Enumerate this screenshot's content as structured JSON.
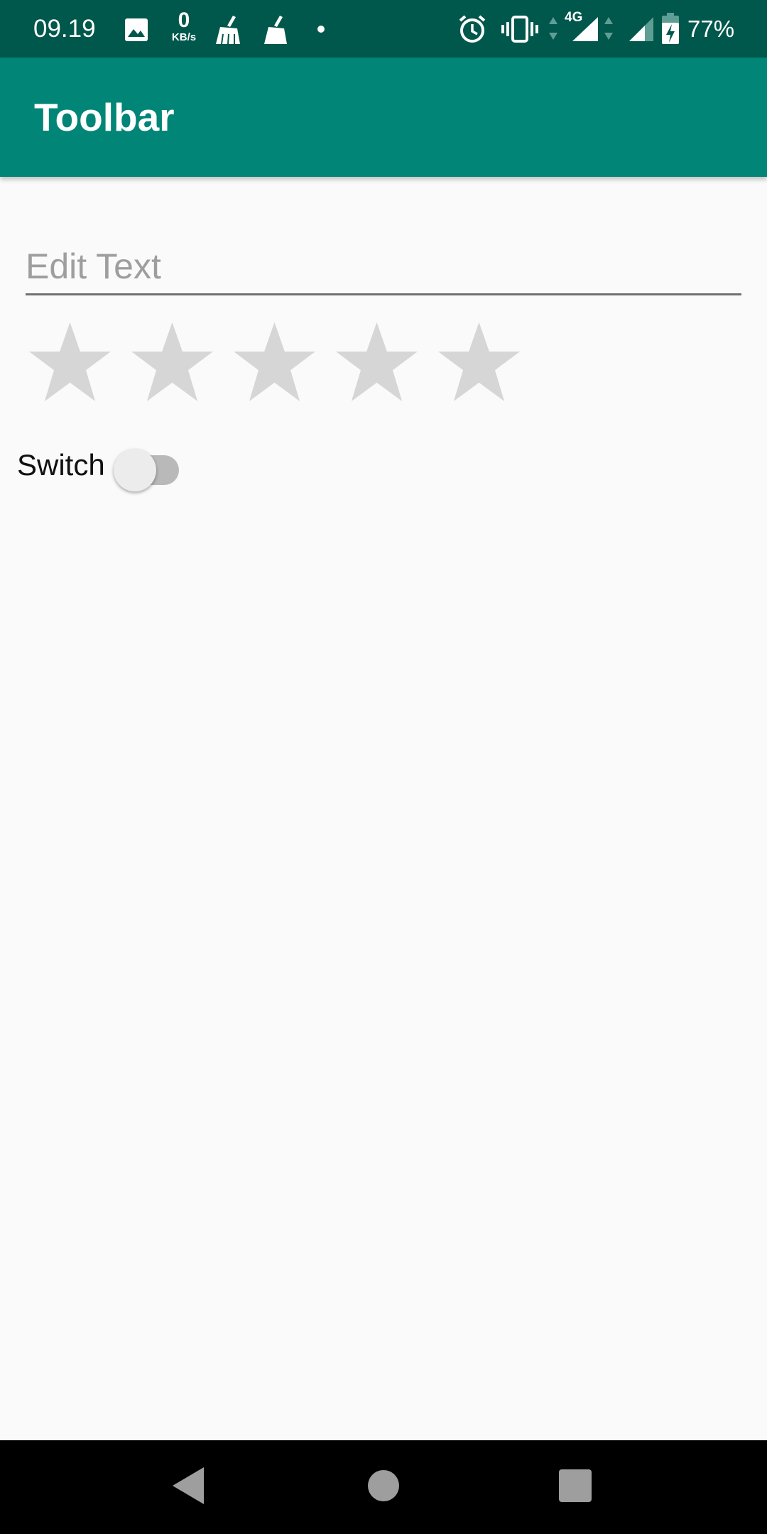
{
  "status_bar": {
    "time": "09.19",
    "data_rate_value": "0",
    "data_rate_unit": "KB/s",
    "network_type": "4G",
    "battery_percent": "77%",
    "icons": [
      "image-icon",
      "broom-icon",
      "broom-icon",
      "dot-icon",
      "alarm-icon",
      "vibrate-icon",
      "signal-icon",
      "signal-icon",
      "battery-charging-icon"
    ],
    "background_color": "#00574b"
  },
  "app_bar": {
    "title": "Toolbar",
    "background_color": "#008577"
  },
  "form": {
    "edit_text_placeholder": "Edit Text",
    "edit_text_value": "",
    "rating": {
      "stars_total": 5,
      "value": 0
    },
    "switch": {
      "label": "Switch",
      "checked": false
    }
  },
  "nav_bar": {
    "buttons": [
      "back-icon",
      "home-icon",
      "recents-icon"
    ]
  }
}
